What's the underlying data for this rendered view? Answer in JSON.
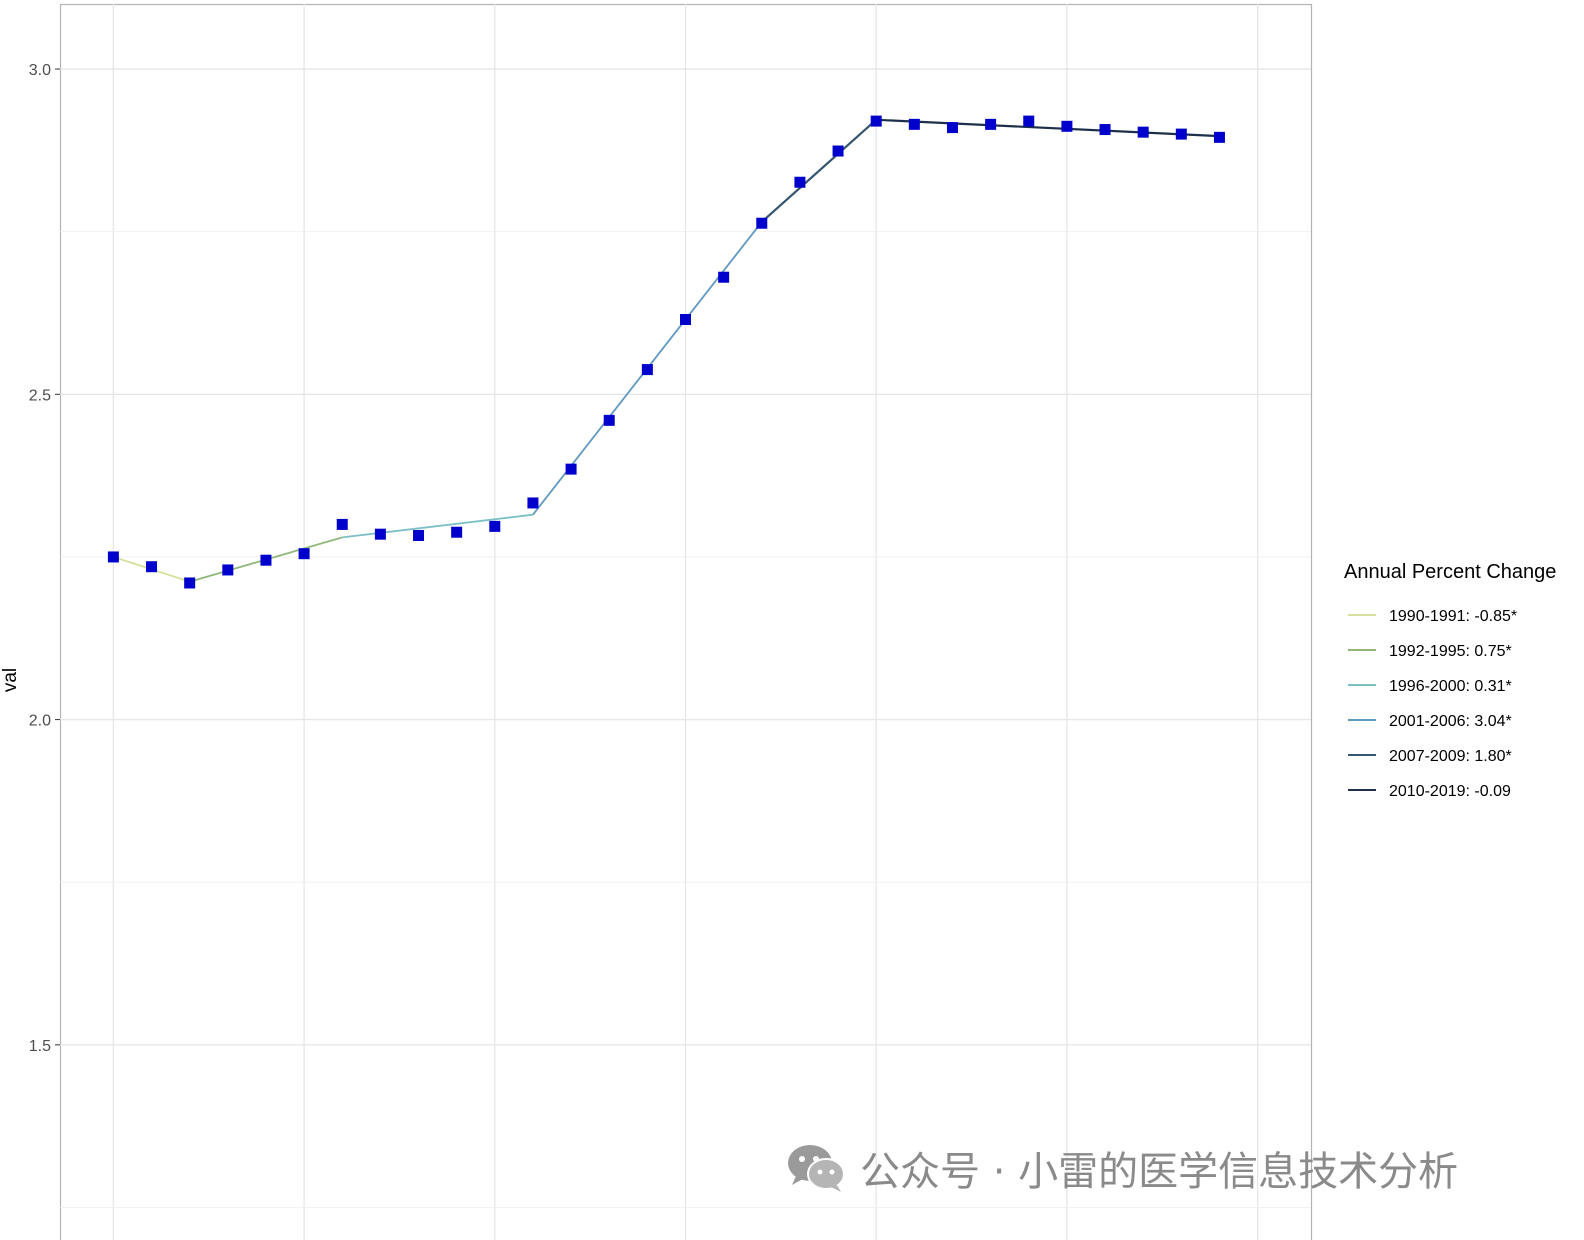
{
  "chart_data": {
    "type": "line",
    "title": "",
    "xlabel": "",
    "ylabel": "val",
    "ylim": [
      1.2,
      3.1
    ],
    "xlim": [
      1988.6,
      2021.4
    ],
    "y_ticks": [
      1.5,
      2.0,
      2.5,
      3.0
    ],
    "y_tick_labels": [
      "1.5",
      "2.0",
      "2.5",
      "3.0"
    ],
    "x_gridlines": [
      1990,
      1995,
      2000,
      2005,
      2010,
      2015,
      2020
    ],
    "grid": true,
    "points": {
      "shape": "square",
      "color": "#0000cd",
      "x": [
        1990,
        1991,
        1992,
        1993,
        1994,
        1995,
        1996,
        1997,
        1998,
        1999,
        2000,
        2001,
        2002,
        2003,
        2004,
        2005,
        2006,
        2007,
        2008,
        2009,
        2010,
        2011,
        2012,
        2013,
        2014,
        2015,
        2016,
        2017,
        2018,
        2019
      ],
      "y": [
        2.25,
        2.235,
        2.21,
        2.23,
        2.245,
        2.255,
        2.3,
        2.285,
        2.283,
        2.288,
        2.297,
        2.333,
        2.385,
        2.46,
        2.538,
        2.615,
        2.68,
        2.763,
        2.826,
        2.874,
        2.92,
        2.915,
        2.91,
        2.915,
        2.92,
        2.912,
        2.907,
        2.903,
        2.9,
        2.895
      ]
    },
    "series": [
      {
        "name": "1990-1991: -0.85*",
        "color": "#d8df9a",
        "x": [
          1990,
          1992
        ],
        "y": [
          2.25,
          2.212
        ]
      },
      {
        "name": "1992-1995: 0.75*",
        "color": "#8fb878",
        "x": [
          1992,
          1996
        ],
        "y": [
          2.212,
          2.28
        ]
      },
      {
        "name": "1996-2000: 0.31*",
        "color": "#7cc0c6",
        "x": [
          1996,
          2001
        ],
        "y": [
          2.28,
          2.315
        ]
      },
      {
        "name": "2001-2006: 3.04*",
        "color": "#5f98c0",
        "x": [
          2001,
          2007
        ],
        "y": [
          2.315,
          2.765
        ]
      },
      {
        "name": "2007-2009: 1.80*",
        "color": "#35566e",
        "x": [
          2007,
          2010
        ],
        "y": [
          2.765,
          2.922
        ]
      },
      {
        "name": "2010-2019: -0.09",
        "color": "#1e2f4a",
        "x": [
          2010,
          2019
        ],
        "y": [
          2.922,
          2.897
        ]
      }
    ],
    "legend": {
      "title": "Annual Percent Change",
      "placement": "right"
    }
  },
  "watermark": {
    "icon": "wechat-icon",
    "text": "公众号 · 小雷的医学信息技术分析"
  }
}
